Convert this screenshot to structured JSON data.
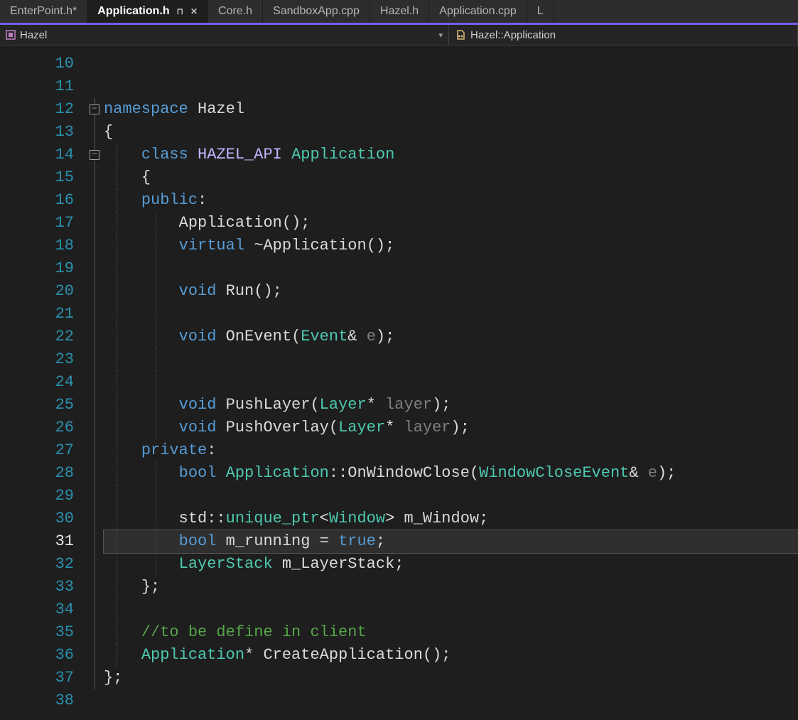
{
  "tabs": [
    {
      "label": "EnterPoint.h*",
      "active": false
    },
    {
      "label": "Application.h",
      "active": true,
      "pinned": true,
      "closable": true
    },
    {
      "label": "Core.h",
      "active": false
    },
    {
      "label": "SandboxApp.cpp",
      "active": false
    },
    {
      "label": "Hazel.h",
      "active": false
    },
    {
      "label": "Application.cpp",
      "active": false
    },
    {
      "label": "L",
      "active": false,
      "truncated": true
    }
  ],
  "nav": {
    "left": "Hazel",
    "right": "Hazel::Application"
  },
  "editor": {
    "first_line": 10,
    "current_line": 31,
    "lines": [
      {
        "n": 10,
        "indent": 0,
        "fold": "",
        "tokens": []
      },
      {
        "n": 11,
        "indent": 0,
        "fold": "",
        "tokens": []
      },
      {
        "n": 12,
        "indent": 0,
        "fold": "box",
        "tokens": [
          [
            "kw",
            "namespace"
          ],
          [
            "punc",
            " "
          ],
          [
            "id",
            "Hazel"
          ]
        ]
      },
      {
        "n": 13,
        "indent": 0,
        "fold": "line",
        "tokens": [
          [
            "punc",
            "{"
          ]
        ]
      },
      {
        "n": 14,
        "indent": 1,
        "fold": "box",
        "tokens": [
          [
            "kw",
            "class"
          ],
          [
            "punc",
            " "
          ],
          [
            "macro",
            "HAZEL_API"
          ],
          [
            "punc",
            " "
          ],
          [
            "type",
            "Application"
          ]
        ]
      },
      {
        "n": 15,
        "indent": 1,
        "fold": "line",
        "tokens": [
          [
            "punc",
            "{"
          ]
        ]
      },
      {
        "n": 16,
        "indent": 1,
        "fold": "line",
        "tokens": [
          [
            "kw",
            "public"
          ],
          [
            "punc",
            ":"
          ]
        ]
      },
      {
        "n": 17,
        "indent": 2,
        "fold": "line",
        "tokens": [
          [
            "id",
            "Application"
          ],
          [
            "punc",
            "();"
          ]
        ]
      },
      {
        "n": 18,
        "indent": 2,
        "fold": "line",
        "tokens": [
          [
            "kw",
            "virtual"
          ],
          [
            "punc",
            " ~"
          ],
          [
            "id",
            "Application"
          ],
          [
            "punc",
            "();"
          ]
        ]
      },
      {
        "n": 19,
        "indent": 2,
        "fold": "line",
        "tokens": []
      },
      {
        "n": 20,
        "indent": 2,
        "fold": "line",
        "tokens": [
          [
            "kw",
            "void"
          ],
          [
            "punc",
            " "
          ],
          [
            "id",
            "Run"
          ],
          [
            "punc",
            "();"
          ]
        ]
      },
      {
        "n": 21,
        "indent": 2,
        "fold": "line",
        "tokens": []
      },
      {
        "n": 22,
        "indent": 2,
        "fold": "line",
        "tokens": [
          [
            "kw",
            "void"
          ],
          [
            "punc",
            " "
          ],
          [
            "id",
            "OnEvent"
          ],
          [
            "punc",
            "("
          ],
          [
            "type",
            "Event"
          ],
          [
            "punc",
            "& "
          ],
          [
            "dim",
            "e"
          ],
          [
            "punc",
            ");"
          ]
        ]
      },
      {
        "n": 23,
        "indent": 2,
        "fold": "line",
        "tokens": []
      },
      {
        "n": 24,
        "indent": 2,
        "fold": "line",
        "tokens": []
      },
      {
        "n": 25,
        "indent": 2,
        "fold": "line",
        "tokens": [
          [
            "kw",
            "void"
          ],
          [
            "punc",
            " "
          ],
          [
            "id",
            "PushLayer"
          ],
          [
            "punc",
            "("
          ],
          [
            "type",
            "Layer"
          ],
          [
            "punc",
            "* "
          ],
          [
            "dim",
            "layer"
          ],
          [
            "punc",
            ");"
          ]
        ]
      },
      {
        "n": 26,
        "indent": 2,
        "fold": "line",
        "tokens": [
          [
            "kw",
            "void"
          ],
          [
            "punc",
            " "
          ],
          [
            "id",
            "PushOverlay"
          ],
          [
            "punc",
            "("
          ],
          [
            "type",
            "Layer"
          ],
          [
            "punc",
            "* "
          ],
          [
            "dim",
            "layer"
          ],
          [
            "punc",
            ");"
          ]
        ]
      },
      {
        "n": 27,
        "indent": 1,
        "fold": "line",
        "tokens": [
          [
            "kw",
            "private"
          ],
          [
            "punc",
            ":"
          ]
        ]
      },
      {
        "n": 28,
        "indent": 2,
        "fold": "line",
        "tokens": [
          [
            "kw",
            "bool"
          ],
          [
            "punc",
            " "
          ],
          [
            "type",
            "Application"
          ],
          [
            "punc",
            "::"
          ],
          [
            "id",
            "OnWindowClose"
          ],
          [
            "punc",
            "("
          ],
          [
            "type",
            "WindowCloseEvent"
          ],
          [
            "punc",
            "& "
          ],
          [
            "dim",
            "e"
          ],
          [
            "punc",
            ");"
          ]
        ]
      },
      {
        "n": 29,
        "indent": 2,
        "fold": "line",
        "tokens": []
      },
      {
        "n": 30,
        "indent": 2,
        "fold": "line",
        "tokens": [
          [
            "id",
            "std"
          ],
          [
            "punc",
            "::"
          ],
          [
            "type",
            "unique_ptr"
          ],
          [
            "punc",
            "<"
          ],
          [
            "type",
            "Window"
          ],
          [
            "punc",
            "> "
          ],
          [
            "id",
            "m_Window"
          ],
          [
            "punc",
            ";"
          ]
        ]
      },
      {
        "n": 31,
        "indent": 2,
        "fold": "line",
        "tokens": [
          [
            "kw",
            "bool"
          ],
          [
            "punc",
            " "
          ],
          [
            "id",
            "m_running"
          ],
          [
            "punc",
            " = "
          ],
          [
            "lit",
            "true"
          ],
          [
            "punc",
            ";"
          ]
        ]
      },
      {
        "n": 32,
        "indent": 2,
        "fold": "line",
        "tokens": [
          [
            "type",
            "LayerStack"
          ],
          [
            "punc",
            " "
          ],
          [
            "id",
            "m_LayerStack"
          ],
          [
            "punc",
            ";"
          ]
        ]
      },
      {
        "n": 33,
        "indent": 1,
        "fold": "line",
        "tokens": [
          [
            "punc",
            "};"
          ]
        ]
      },
      {
        "n": 34,
        "indent": 1,
        "fold": "line",
        "tokens": []
      },
      {
        "n": 35,
        "indent": 1,
        "fold": "line",
        "tokens": [
          [
            "cmt",
            "//to be define in client"
          ]
        ]
      },
      {
        "n": 36,
        "indent": 1,
        "fold": "line",
        "tokens": [
          [
            "type",
            "Application"
          ],
          [
            "punc",
            "* "
          ],
          [
            "id",
            "CreateApplication"
          ],
          [
            "punc",
            "();"
          ]
        ]
      },
      {
        "n": 37,
        "indent": 0,
        "fold": "line",
        "tokens": [
          [
            "punc",
            "};"
          ]
        ]
      },
      {
        "n": 38,
        "indent": 0,
        "fold": "",
        "tokens": []
      }
    ]
  }
}
